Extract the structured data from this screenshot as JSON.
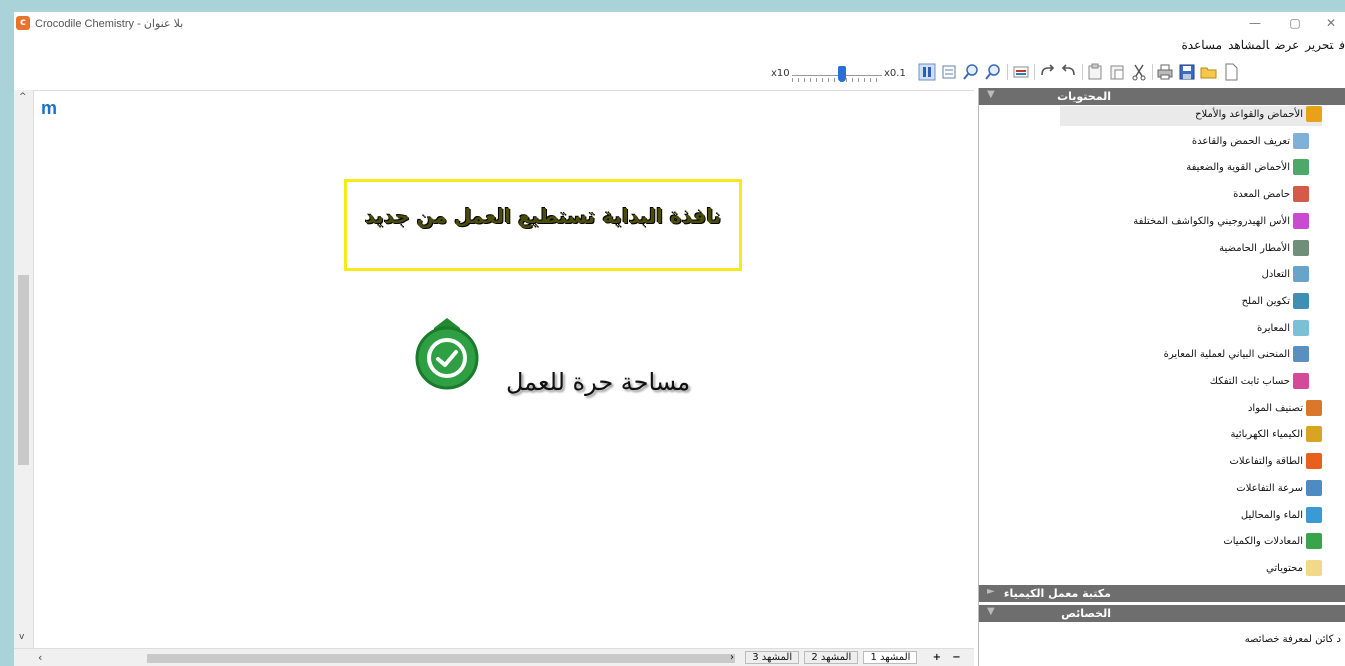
{
  "window": {
    "title": "Crocodile Chemistry - بلا عنوان",
    "app_icon_letter": "c",
    "minimize": "—",
    "maximize": "▢",
    "close": "✕"
  },
  "menu": {
    "items": [
      "ف",
      "تحرير",
      "عرض",
      "المشاهد",
      "مساعدة"
    ]
  },
  "toolbar": {
    "zoom_min_label": "x10",
    "zoom_max_label": "x0.1",
    "zoom_level": 0.55,
    "icons": [
      "pause-icon",
      "fit-page-icon",
      "zoom-in-icon",
      "zoom-out-icon",
      "graph-icon",
      "redo-icon",
      "undo-icon",
      "paste-special-icon",
      "paste-icon",
      "cut-icon",
      "print-icon",
      "save-icon",
      "open-icon",
      "new-icon"
    ]
  },
  "canvas": {
    "corner_letter": "m",
    "banner_text": "نافذة البداية تستطيع العمل من جديد",
    "free_area_text": "مساحة حرة للعمل"
  },
  "scenes": {
    "tabs": [
      "المشهد 1",
      "المشهد 2",
      "المشهد 3"
    ],
    "active": 0,
    "add": "+",
    "remove": "−",
    "prev": "›"
  },
  "panel": {
    "contents_header": "المحتويات",
    "tree": [
      {
        "label": "الأحماض والقواعد والأملاح",
        "level": 0,
        "color": "#e8a21a",
        "selected": true
      },
      {
        "label": "تعريف الحمض والقاعدة",
        "level": 1,
        "color": "#7fb0d8"
      },
      {
        "label": "الأحماض القوية والضعيفة",
        "level": 1,
        "color": "#4da86a"
      },
      {
        "label": "حامض المعدة",
        "level": 1,
        "color": "#d45a4a"
      },
      {
        "label": "الأس الهيدروجيني والكواشف المختلفة",
        "level": 1,
        "color": "#c94bd1"
      },
      {
        "label": "الأمطار الحامضية",
        "level": 1,
        "color": "#6f8f7a"
      },
      {
        "label": "التعادل",
        "level": 1,
        "color": "#6aa3c8"
      },
      {
        "label": "تكوين الملح",
        "level": 1,
        "color": "#3f8fb5"
      },
      {
        "label": "المعايرة",
        "level": 1,
        "color": "#7cc0d6"
      },
      {
        "label": "المنحنى البياني لعملية المعايرة",
        "level": 1,
        "color": "#5a8fc0"
      },
      {
        "label": "حساب ثابت التفكك",
        "level": 1,
        "color": "#d34a9a"
      },
      {
        "label": "تصنيف المواد",
        "level": 0,
        "color": "#d9772a"
      },
      {
        "label": "الكيمياء الكهربائية",
        "level": 0,
        "color": "#d8a522"
      },
      {
        "label": "الطاقة والتفاعلات",
        "level": 0,
        "color": "#e85f1e"
      },
      {
        "label": "سرعة التفاعلات",
        "level": 0,
        "color": "#4c8bc4"
      },
      {
        "label": "الماء والمحاليل",
        "level": 0,
        "color": "#3a9ad3"
      },
      {
        "label": "المعادلات والكميات",
        "level": 0,
        "color": "#39a54a"
      },
      {
        "label": "محتوياتي",
        "level": 0,
        "color": "#f2d88a"
      }
    ],
    "library_header": "مكتبة معمل الكيمياء",
    "properties_header": "الخصائص",
    "properties_hint": "د كائن لمعرفة خصائصه"
  }
}
